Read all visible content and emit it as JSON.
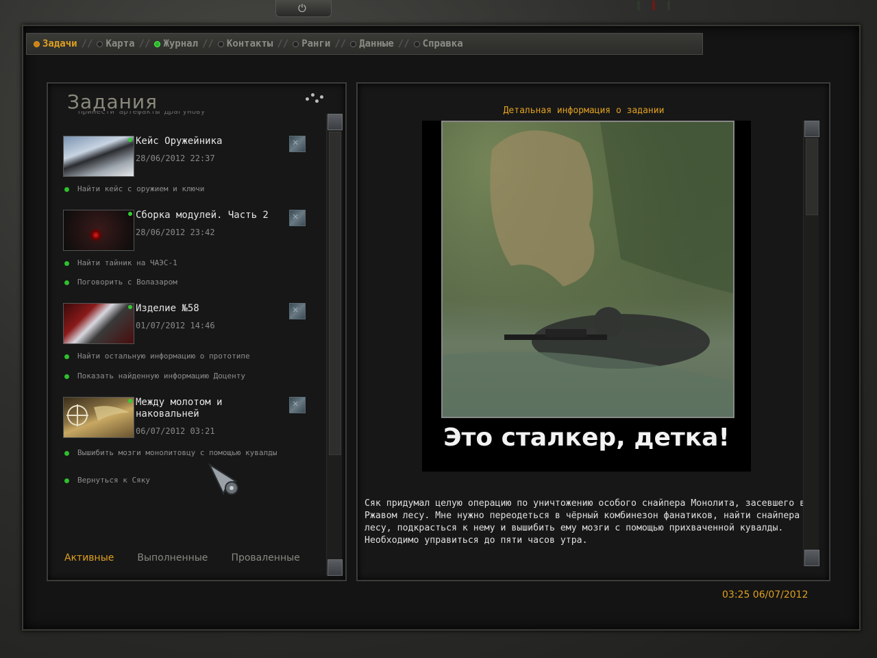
{
  "tabs": [
    {
      "label": "Задачи",
      "state": "active"
    },
    {
      "label": "Карта",
      "state": "normal"
    },
    {
      "label": "Журнал",
      "state": "lit"
    },
    {
      "label": "Контакты",
      "state": "normal"
    },
    {
      "label": "Ранги",
      "state": "normal"
    },
    {
      "label": "Данные",
      "state": "normal"
    },
    {
      "label": "Справка",
      "state": "normal"
    }
  ],
  "tasks_panel": {
    "title": "Задания",
    "cutoff_text": "Принести артефакты Драгунову",
    "quests": [
      {
        "title": "Кейс Оружейника",
        "date": "28/06/2012  22:37",
        "objectives": [
          "Найти кейс с оружием и ключи"
        ]
      },
      {
        "title": "Сборка модулей. Часть 2",
        "date": "28/06/2012  23:42",
        "objectives": [
          "Найти тайник на ЧАЭС-1",
          "Поговорить с Волазаром"
        ]
      },
      {
        "title": "Изделие №58",
        "date": "01/07/2012  14:46",
        "objectives": [
          "Найти остальную информацию о прототипе",
          "Показать найденную информацию Доценту"
        ]
      },
      {
        "title": "Между молотом и наковальней",
        "date": "06/07/2012  03:21",
        "objectives": [
          "Вышибить мозги монолитовцу с помощью кувалды",
          "Вернуться к Сяку"
        ]
      }
    ],
    "filter_tabs": {
      "active": "Активные",
      "completed": "Выполненные",
      "failed": "Проваленные"
    }
  },
  "detail_panel": {
    "title": "Детальная информация о задании",
    "image_caption": "Это сталкер, детка!",
    "description": "Сяк придумал целую операцию по уничтожению особого снайпера Монолита, засевшего в Ржавом лесу. Мне нужно переодеться в чёрный комбинезон фанатиков, найти снайпера в лесу, подкрасться к нему и вышибить ему мозги с помощью прихваченной кувалды. Необходимо управиться до пяти часов утра."
  },
  "clock": "03:25  06/07/2012",
  "colors": {
    "accent": "#e0a020",
    "objective_dot": "#2ec02e"
  }
}
